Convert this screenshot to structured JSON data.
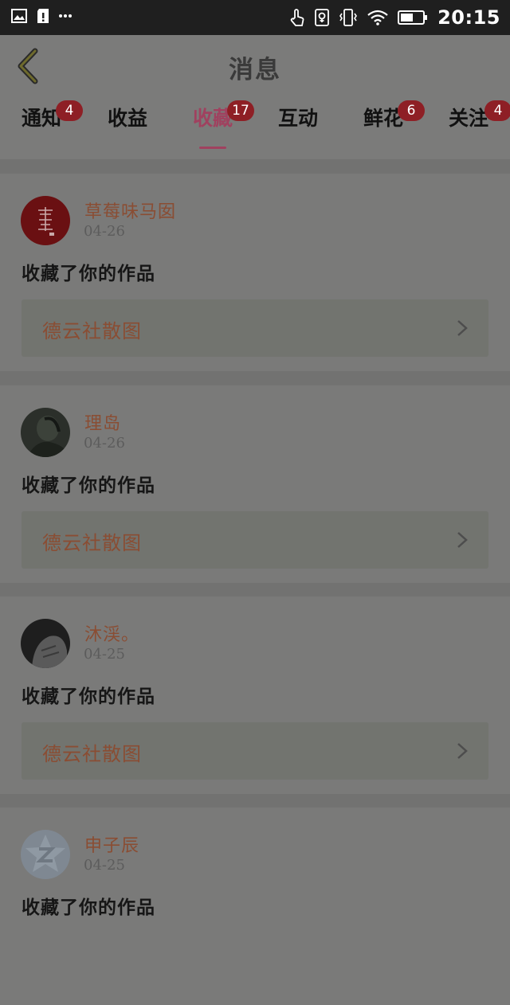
{
  "status_bar": {
    "time": "20:15",
    "left_icons": [
      "image-icon",
      "sd-card-alert-icon",
      "more-icon"
    ],
    "right_icons": [
      "touch-icon",
      "nfc-icon",
      "vibrate-icon",
      "wifi-icon",
      "battery-icon"
    ]
  },
  "header": {
    "title": "消息",
    "back_icon": "chevron-left-icon"
  },
  "tabs": [
    {
      "label": "通知",
      "badge": "4",
      "active": false
    },
    {
      "label": "收益",
      "badge": "",
      "active": false
    },
    {
      "label": "收藏",
      "badge": "17",
      "active": true
    },
    {
      "label": "互动",
      "badge": "",
      "active": false
    },
    {
      "label": "鲜花",
      "badge": "6",
      "active": false
    },
    {
      "label": "关注",
      "badge": "4",
      "active": false
    }
  ],
  "colors": {
    "accent": "#a0415f",
    "badge": "#8e1f25",
    "name_text": "#8a4d33"
  },
  "messages": [
    {
      "user": "草莓味马囡",
      "date": "04-26",
      "action": "收藏了你的作品",
      "work_title": "德云社散图",
      "avatar": "red-seal-avatar"
    },
    {
      "user": "理岛",
      "date": "04-26",
      "action": "收藏了你的作品",
      "work_title": "德云社散图",
      "avatar": "dark-photo-avatar"
    },
    {
      "user": "沐渓。",
      "date": "04-25",
      "action": "收藏了你的作品",
      "work_title": "德云社散图",
      "avatar": "grey-photo-avatar"
    },
    {
      "user": "申子辰",
      "date": "04-25",
      "action": "收藏了你的作品",
      "avatar": "default-z-avatar"
    }
  ]
}
